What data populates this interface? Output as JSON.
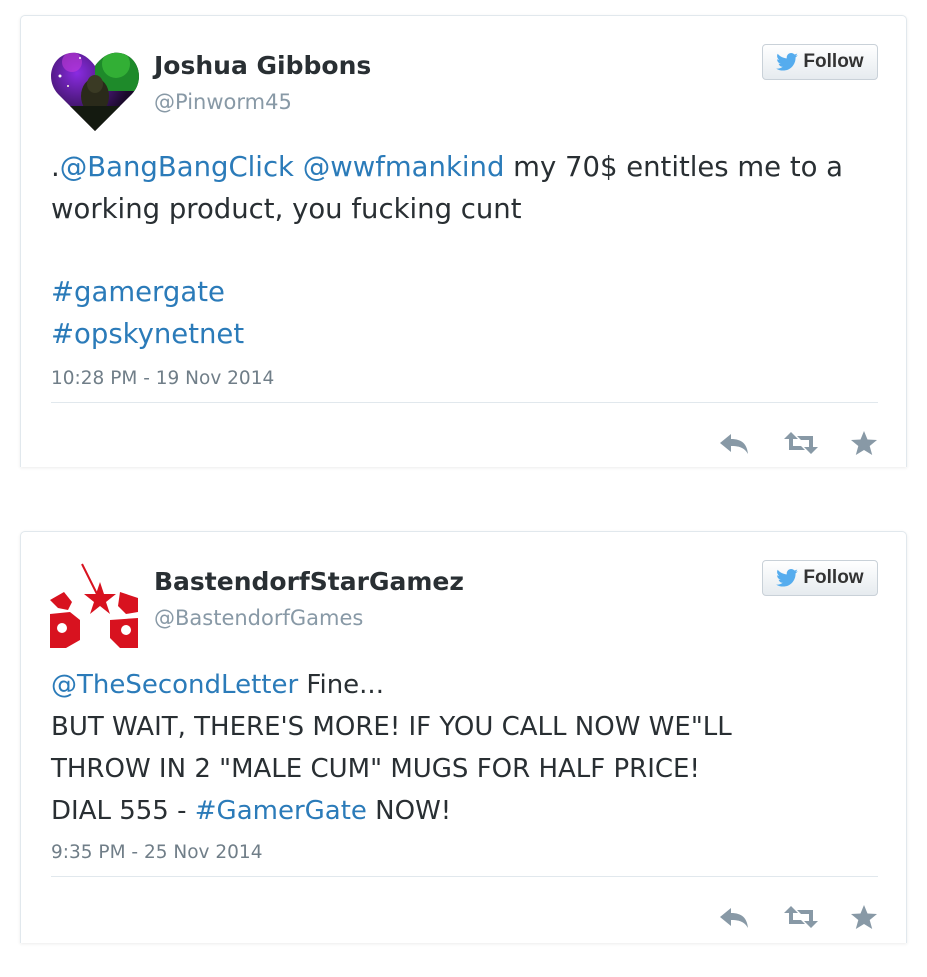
{
  "tweets": [
    {
      "author_name": "Joshua Gibbons",
      "author_handle": "@Pinworm45",
      "follow_label": "Follow",
      "text_lines": [
        [
          {
            "text": ".",
            "type": "text"
          },
          {
            "text": "@BangBangClick",
            "type": "link"
          },
          {
            "text": " ",
            "type": "text"
          },
          {
            "text": "@wwfmankind",
            "type": "link"
          },
          {
            "text": " my 70$ entitles me to a",
            "type": "text"
          }
        ],
        [
          {
            "text": "working product, you fucking cunt",
            "type": "text"
          }
        ],
        [],
        [
          {
            "text": "#gamergate",
            "type": "link"
          }
        ],
        [
          {
            "text": "#opskynetnet",
            "type": "link"
          }
        ]
      ],
      "timestamp": "10:28 PM - 19 Nov 2014",
      "avatar_icon": "heart-avatar-icon"
    },
    {
      "author_name": "BastendorfStarGamez",
      "author_handle": "@BastendorfGames",
      "follow_label": "Follow",
      "text_lines": [
        [
          {
            "text": "@TheSecondLetter",
            "type": "link"
          },
          {
            "text": " Fine...",
            "type": "text"
          }
        ],
        [
          {
            "text": "BUT WAIT, THERE'S MORE! IF YOU CALL NOW WE\"LL",
            "type": "text"
          }
        ],
        [
          {
            "text": "THROW IN 2 \"MALE CUM\" MUGS FOR HALF PRICE!",
            "type": "text"
          }
        ],
        [
          {
            "text": "DIAL 555 - ",
            "type": "text"
          },
          {
            "text": "#GamerGate",
            "type": "link"
          },
          {
            "text": " NOW!",
            "type": "text"
          }
        ]
      ],
      "timestamp": "9:35 PM - 25 Nov 2014",
      "avatar_icon": "red-star-skull-avatar-icon"
    }
  ],
  "colors": {
    "link": "#2b7bb9",
    "text": "#292f33",
    "muted": "#8899a6",
    "twitter_blue": "#55acee",
    "action_icon": "#8899a6"
  },
  "icons": {
    "follow": "twitter-bird-icon",
    "reply": "reply-icon",
    "retweet": "retweet-icon",
    "favorite": "star-icon"
  }
}
